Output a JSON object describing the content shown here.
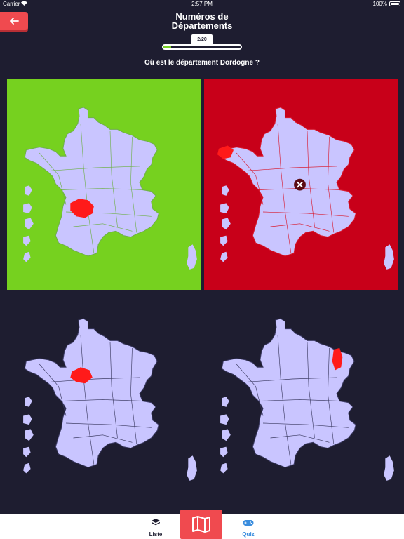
{
  "status_bar": {
    "carrier": "Carrier",
    "time": "2:57 PM",
    "battery": "100%"
  },
  "header": {
    "title_line1": "Numéros de",
    "title_line2": "Départements",
    "counter": "2/20",
    "progress": 0.1
  },
  "question": "Où est le département Dordogne ?",
  "tiles": [
    {
      "state": "correct",
      "background": "#76d11f",
      "highlight": "Dordogne"
    },
    {
      "state": "wrong",
      "background": "#c80019",
      "highlight": "Finistère"
    },
    {
      "state": "neutral",
      "background": "#1e1d30",
      "highlight": "Sarthe"
    },
    {
      "state": "neutral",
      "background": "#1e1d30",
      "highlight": "Meuse"
    }
  ],
  "colors": {
    "map_fill": "#c9c5ff",
    "highlight": "#ff1a1a",
    "accent": "#f04a4f"
  },
  "tab_bar": {
    "liste_label": "Liste",
    "quiz_label": "Quiz",
    "liste_icon": "layers-icon",
    "map_icon": "map-icon",
    "quiz_icon": "gamepad-icon"
  }
}
